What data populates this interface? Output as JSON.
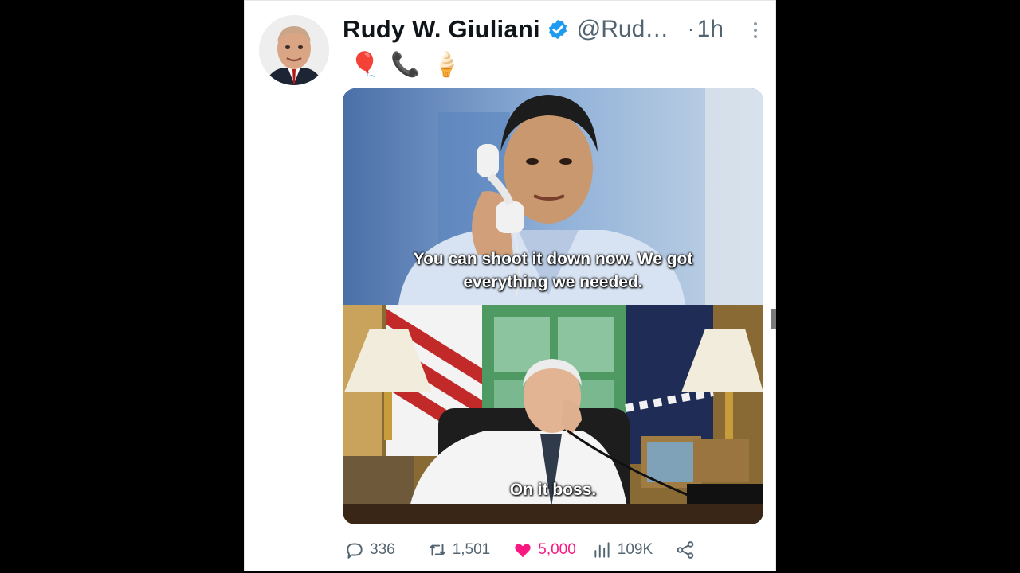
{
  "tweet": {
    "author_name": "Rudy W. Giuliani",
    "handle": "@Rud…",
    "separator": "·",
    "time": "1h",
    "emojis": [
      "🎈",
      "📞",
      "🍦"
    ],
    "verified_color": "#1d9bf0",
    "media": {
      "top_caption": "You can shoot it down now. We got everything we needed.",
      "bottom_caption": "On it boss."
    }
  },
  "actions": {
    "replies": "336",
    "retweets": "1,501",
    "likes": "5,000",
    "views": "109K",
    "like_color": "#f91880"
  }
}
